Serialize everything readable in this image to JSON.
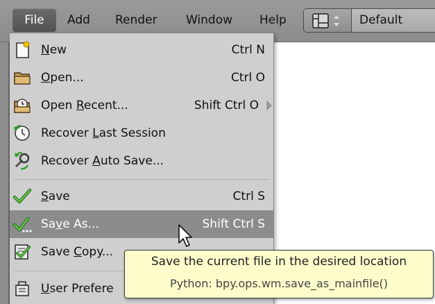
{
  "menubar": {
    "items": [
      "File",
      "Add",
      "Render",
      "Window",
      "Help"
    ],
    "screen_layout": "Default"
  },
  "file_menu": {
    "items": [
      {
        "label_pre": "",
        "mnemonic": "N",
        "label_post": "ew",
        "shortcut": "Ctrl N",
        "icon": "new-file-icon"
      },
      {
        "label_pre": "",
        "mnemonic": "O",
        "label_post": "pen...",
        "shortcut": "Ctrl O",
        "icon": "folder-open-icon"
      },
      {
        "label_pre": "Open ",
        "mnemonic": "R",
        "label_post": "ecent...",
        "shortcut": "Shift Ctrl O",
        "icon": "open-recent-icon",
        "submenu": true
      },
      {
        "label_pre": "Recover ",
        "mnemonic": "L",
        "label_post": "ast Session",
        "shortcut": "",
        "icon": "recover-session-icon"
      },
      {
        "label_pre": "Recover ",
        "mnemonic": "A",
        "label_post": "uto Save...",
        "shortcut": "",
        "icon": "recover-auto-icon"
      },
      {
        "label_pre": "",
        "mnemonic": "S",
        "label_post": "ave",
        "shortcut": "Ctrl S",
        "icon": "save-check-icon"
      },
      {
        "label_pre": "Sa",
        "mnemonic": "v",
        "label_post": "e As...",
        "shortcut": "Shift Ctrl S",
        "icon": "save-as-icon",
        "highlighted": true
      },
      {
        "label_pre": "Save ",
        "mnemonic": "C",
        "label_post": "opy...",
        "shortcut": "",
        "icon": "save-copy-icon"
      },
      {
        "label_pre": "",
        "mnemonic": "U",
        "label_post": "ser Prefere",
        "shortcut": "",
        "icon": "preferences-icon"
      }
    ]
  },
  "tooltip": {
    "description": "Save the current file in the desired location",
    "python": "Python: bpy.ops.wm.save_as_mainfile()"
  },
  "colors": {
    "menubar": "#8f8f8f",
    "menu_bg": "#cfcfcf",
    "highlight": "#8c8c8c",
    "tooltip_bg": "#fffccc"
  }
}
